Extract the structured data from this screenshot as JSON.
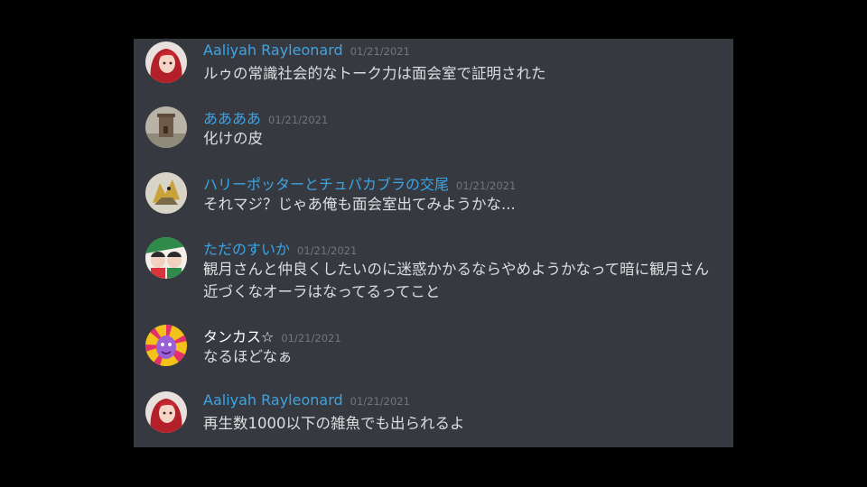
{
  "colors": {
    "background": "#000000",
    "panel": "#36393f",
    "username_blue": "#3ba5e6",
    "username_white": "#ffffff",
    "timestamp": "#72767d",
    "text": "#dcddde"
  },
  "messages": [
    {
      "username": "Aaliyah Rayleonard",
      "username_color": "#3ba5e6",
      "timestamp": "01/21/2021",
      "content": "ルゥの常識社会的なトーク力は面会室で証明された",
      "avatar_icon": "red-hair-anime-girl-icon"
    },
    {
      "username": "ああああ",
      "username_color": "#3ba5e6",
      "timestamp": "01/21/2021",
      "content": "化けの皮",
      "avatar_icon": "stone-tower-icon"
    },
    {
      "username": "ハリーポッターとチュパカブラの交尾",
      "username_color": "#3ba5e6",
      "timestamp": "01/21/2021",
      "content": "それマジ？じゃあ俺も面会室出てみようかな...",
      "avatar_icon": "creature-drawing-icon"
    },
    {
      "username": "ただのすいか",
      "username_color": "#3ba5e6",
      "timestamp": "01/21/2021",
      "content": "観月さんと仲良くしたいのに迷惑かかるならやめようかなって暗に観月さん近づくなオーラはなってるってこと",
      "avatar_icon": "watermelon-characters-icon"
    },
    {
      "username": "タンカス☆",
      "username_color": "#ffffff",
      "timestamp": "01/21/2021",
      "content": "なるほどなぁ",
      "avatar_icon": "purple-character-sunburst-icon"
    },
    {
      "username": "Aaliyah Rayleonard",
      "username_color": "#3ba5e6",
      "timestamp": "01/21/2021",
      "content": "再生数1000以下の雑魚でも出られるよ",
      "avatar_icon": "red-hair-anime-girl-icon"
    }
  ]
}
